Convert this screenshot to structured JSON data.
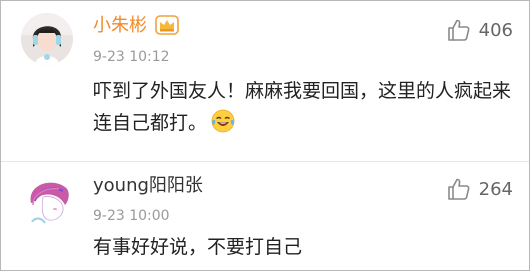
{
  "comments": [
    {
      "username": "小朱彬",
      "time": "9-23 10:12",
      "text": "吓到了外国友人！麻麻我要回国，这里的人疯起来连自己都打。",
      "likes": "406",
      "name_color": "#f28a2a",
      "icons": [
        "vip-crown-icon",
        "laughing-tears-emoji-icon",
        "thumbs-up-icon"
      ]
    },
    {
      "username": "young阳阳张",
      "time": "9-23 10:00",
      "text": "有事好好说，不要打自己",
      "likes": "264",
      "name_color": "#333333",
      "icons": [
        "thumbs-up-icon"
      ]
    }
  ]
}
